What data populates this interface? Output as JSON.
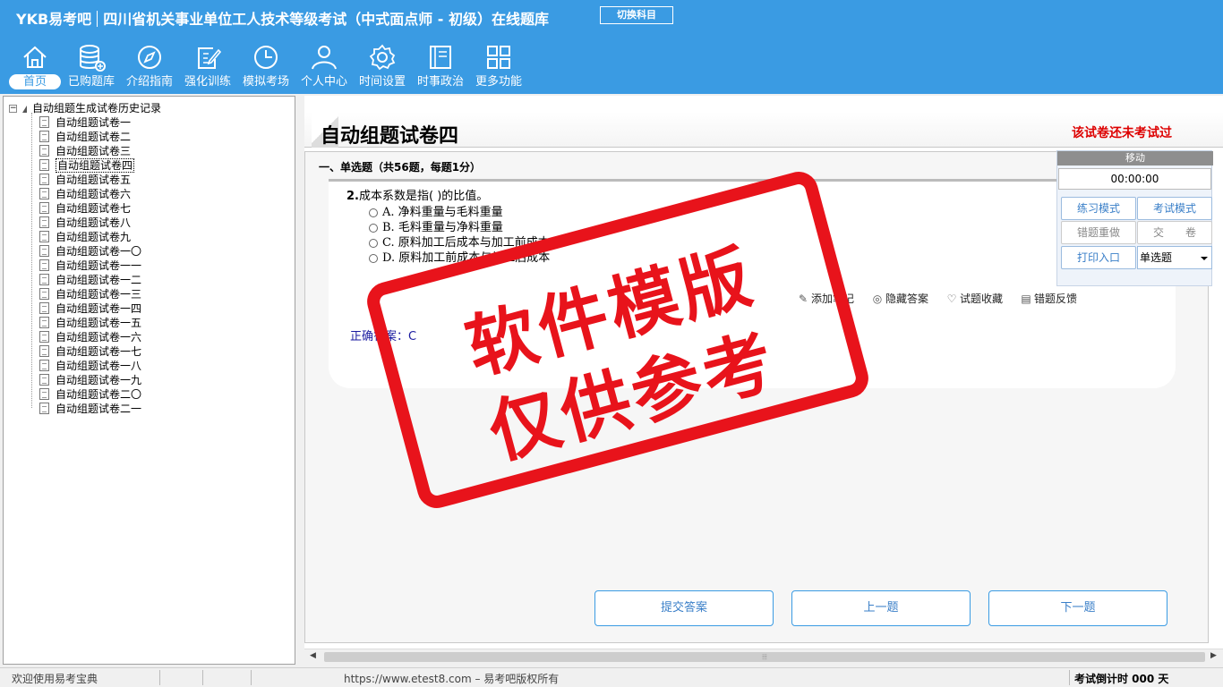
{
  "header": {
    "brand": "YKB易考吧",
    "title": "四川省机关事业单位工人技术等级考试（中式面点师 - 初级）在线题库",
    "switch_label": "切换科目"
  },
  "nav": [
    {
      "label": "首页",
      "icon": "home-icon"
    },
    {
      "label": "已购题库",
      "icon": "database-icon"
    },
    {
      "label": "介绍指南",
      "icon": "compass-icon"
    },
    {
      "label": "强化训练",
      "icon": "edit-icon"
    },
    {
      "label": "模拟考场",
      "icon": "clock-icon"
    },
    {
      "label": "个人中心",
      "icon": "user-icon"
    },
    {
      "label": "时间设置",
      "icon": "gear-icon"
    },
    {
      "label": "时事政治",
      "icon": "book-icon"
    },
    {
      "label": "更多功能",
      "icon": "grid-icon"
    }
  ],
  "tree": {
    "root": "自动组题生成试卷历史记录",
    "items": [
      "自动组题试卷一",
      "自动组题试卷二",
      "自动组题试卷三",
      "自动组题试卷四",
      "自动组题试卷五",
      "自动组题试卷六",
      "自动组题试卷七",
      "自动组题试卷八",
      "自动组题试卷九",
      "自动组题试卷一〇",
      "自动组题试卷一一",
      "自动组题试卷一二",
      "自动组题试卷一三",
      "自动组题试卷一四",
      "自动组题试卷一五",
      "自动组题试卷一六",
      "自动组题试卷一七",
      "自动组题试卷一八",
      "自动组题试卷一九",
      "自动组题试卷二〇",
      "自动组题试卷二一"
    ],
    "selected_index": 3
  },
  "paper": {
    "title": "自动组题试卷四",
    "status": "该试卷还未考试过",
    "section": "一、单选题（共56题，每题1分）"
  },
  "question": {
    "number": "2.",
    "stem": "成本系数是指( )的比值。",
    "options": [
      "A. 净料重量与毛料重量",
      "B. 毛料重量与净料重量",
      "C. 原料加工后成本与加工前成本",
      "D. 原料加工前成本与加工后成本"
    ],
    "answer": "正确答案：C"
  },
  "tools": {
    "note": "添加笔记",
    "hide_answer": "隐藏答案",
    "favorite": "试题收藏",
    "feedback": "错题反馈"
  },
  "buttons": {
    "submit": "提交答案",
    "prev": "上一题",
    "next": "下一题"
  },
  "control": {
    "move": "移动",
    "timer": "00:00:00",
    "practice": "练习模式",
    "exam": "考试模式",
    "redo": "错题重做",
    "hand_in": "交　　卷",
    "print": "打印入口",
    "type_selected": "单选题"
  },
  "stamp": {
    "line1": "软件模版",
    "line2": "仅供参考"
  },
  "statusbar": {
    "welcome": "欢迎使用易考宝典",
    "copyright": "https://www.etest8.com – 易考吧版权所有",
    "countdown": "考试倒计时 000 天"
  },
  "colors": {
    "header_bg": "#3a9be3",
    "accent_blue": "#3a7fc8",
    "stamp_red": "#e8131b",
    "status_red": "#dd0000"
  }
}
